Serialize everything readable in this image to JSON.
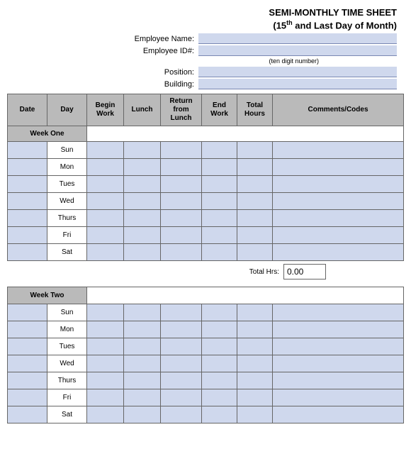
{
  "header": {
    "title_line1": "SEMI-MONTHLY TIME SHEET",
    "title_line2_prefix": "(15",
    "title_line2_sup": "th",
    "title_line2_suffix": " and Last Day of Month)"
  },
  "employee": {
    "name_label": "Employee Name:",
    "name_value": "",
    "id_label": "Employee ID#:",
    "id_value": "",
    "id_hint": "(ten digit number)",
    "position_label": "Position:",
    "position_value": "",
    "building_label": "Building:",
    "building_value": ""
  },
  "columns": {
    "date": "Date",
    "day": "Day",
    "begin": "Begin Work",
    "lunch": "Lunch",
    "return": "Return from Lunch",
    "end": "End Work",
    "total": "Total Hours",
    "comments": "Comments/Codes"
  },
  "week1": {
    "label": "Week One",
    "days": [
      "Sun",
      "Mon",
      "Tues",
      "Wed",
      "Thurs",
      "Fri",
      "Sat"
    ],
    "total_label": "Total Hrs:",
    "total_value": "0.00"
  },
  "week2": {
    "label": "Week Two",
    "days": [
      "Sun",
      "Mon",
      "Tues",
      "Wed",
      "Thurs",
      "Fri",
      "Sat"
    ]
  }
}
